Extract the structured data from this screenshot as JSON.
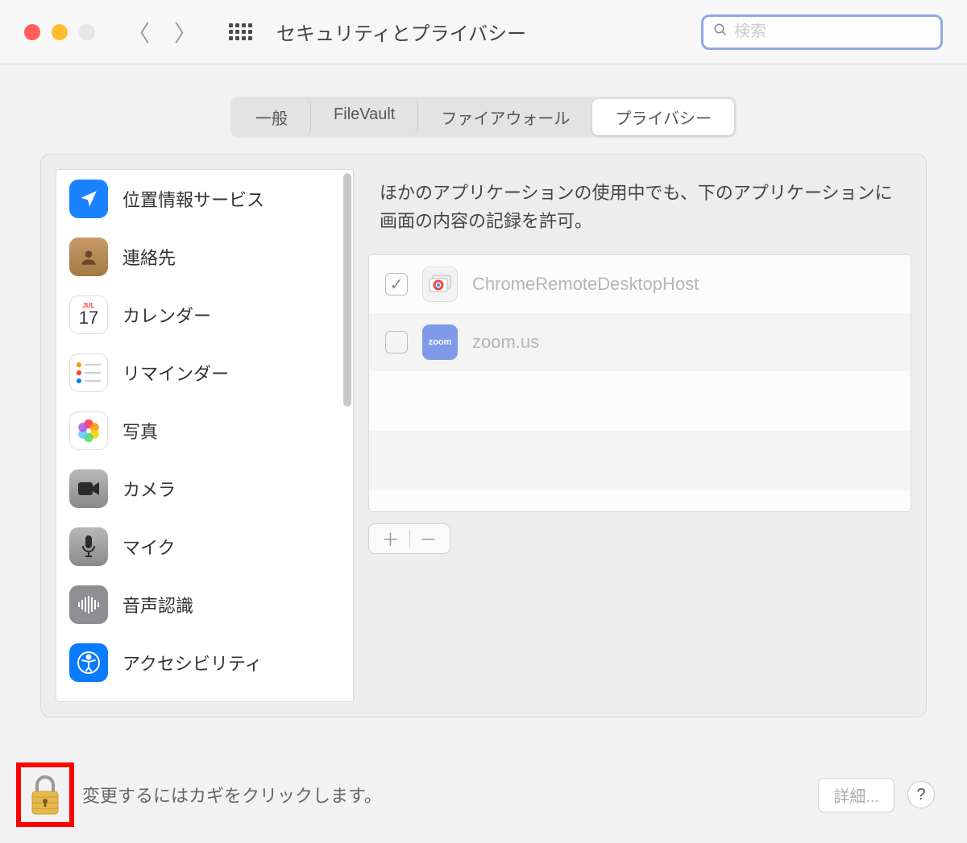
{
  "window": {
    "title": "セキュリティとプライバシー",
    "search_placeholder": "検索"
  },
  "tabs": [
    {
      "label": "一般",
      "active": false
    },
    {
      "label": "FileVault",
      "active": false
    },
    {
      "label": "ファイアウォール",
      "active": false
    },
    {
      "label": "プライバシー",
      "active": true
    }
  ],
  "description": "ほかのアプリケーションの使用中でも、下のアプリケーションに画面の内容の記録を許可。",
  "sidebar": [
    {
      "label": "位置情報サービス",
      "icon": "location",
      "bg": "#1a81ff",
      "fg": "#fff"
    },
    {
      "label": "連絡先",
      "icon": "contacts",
      "bg": "#b68a5a",
      "fg": "#fff"
    },
    {
      "label": "カレンダー",
      "icon": "calendar",
      "bg": "#ffffff",
      "fg": "#ff3b30",
      "day": "17",
      "month": "JUL"
    },
    {
      "label": "リマインダー",
      "icon": "reminders",
      "bg": "#ffffff",
      "fg": "#333"
    },
    {
      "label": "写真",
      "icon": "photos",
      "bg": "#ffffff",
      "fg": "#ff9500"
    },
    {
      "label": "カメラ",
      "icon": "camera",
      "bg": "#a0a0a0",
      "fg": "#333"
    },
    {
      "label": "マイク",
      "icon": "microphone",
      "bg": "#a0a0a0",
      "fg": "#333"
    },
    {
      "label": "音声認識",
      "icon": "speech",
      "bg": "#8e8e93",
      "fg": "#fff"
    },
    {
      "label": "アクセシビリティ",
      "icon": "accessibility",
      "bg": "#0a7aff",
      "fg": "#fff"
    }
  ],
  "apps": [
    {
      "name": "ChromeRemoteDesktopHost",
      "checked": true,
      "icon": "chrome-remote",
      "dimmed": true
    },
    {
      "name": "zoom.us",
      "checked": false,
      "icon": "zoom",
      "dimmed": true
    }
  ],
  "add_remove": {
    "plus": "＋",
    "minus": "－"
  },
  "footer": {
    "lock_text": "変更するにはカギをクリックします。",
    "details_button": "詳細...",
    "help": "?"
  }
}
